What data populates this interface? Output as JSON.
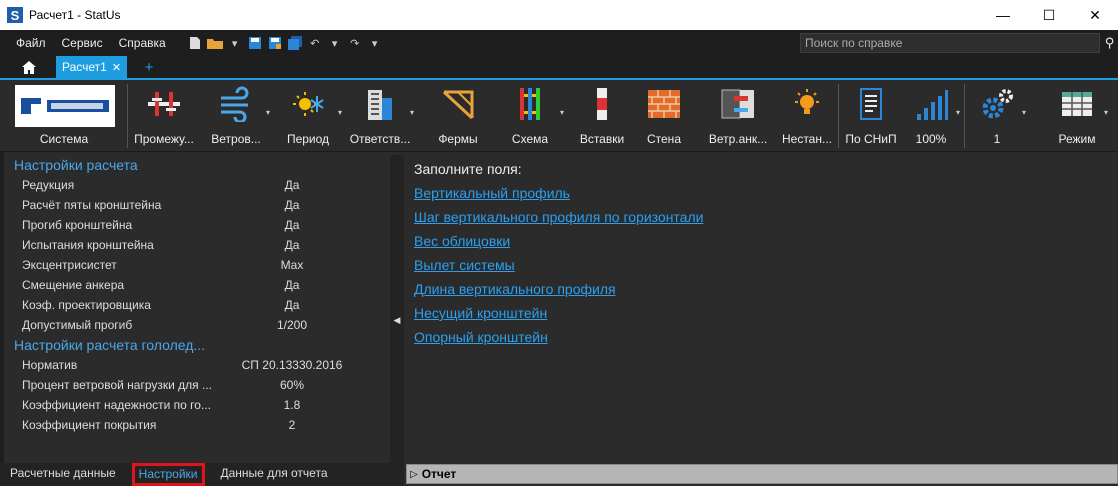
{
  "window": {
    "title": "Расчет1 - StatUs",
    "app_icon": "S"
  },
  "menu": [
    "Файл",
    "Сервис",
    "Справка"
  ],
  "search": {
    "placeholder": "Поиск по справке"
  },
  "tabs": {
    "doc_tab": "Расчет1",
    "close": "✕",
    "add": "+"
  },
  "ribbon": [
    {
      "label": "Система",
      "icon": "ukon-logo-icon"
    },
    {
      "label": "Промежу...",
      "icon": "bracket-icon"
    },
    {
      "label": "Ветров...",
      "icon": "wind-icon"
    },
    {
      "label": "Период",
      "icon": "sun-snow-icon"
    },
    {
      "label": "Ответств...",
      "icon": "building-icon"
    },
    {
      "label": "Фермы",
      "icon": "truss-icon"
    },
    {
      "label": "Схема",
      "icon": "scheme-icon"
    },
    {
      "label": "Вставки",
      "icon": "insert-icon"
    },
    {
      "label": "Стена",
      "icon": "brick-wall-icon"
    },
    {
      "label": "Ветр.анк...",
      "icon": "anchor-icon"
    },
    {
      "label": "Нестан...",
      "icon": "bulb-icon"
    },
    {
      "label": "По СНиП",
      "icon": "document-icon"
    },
    {
      "label": "100%",
      "icon": "signal-bars-icon"
    },
    {
      "label": "1",
      "icon": "gears-icon"
    },
    {
      "label": "Режим",
      "icon": "table-icon"
    }
  ],
  "settings": {
    "section1_title": "Настройки расчета",
    "section1": [
      {
        "name": "Редукция",
        "value": "Да"
      },
      {
        "name": "Расчёт пяты кронштейна",
        "value": "Да"
      },
      {
        "name": "Прогиб кронштейна",
        "value": "Да"
      },
      {
        "name": "Испытания кронштейна",
        "value": "Да"
      },
      {
        "name": "Эксцентрисистет",
        "value": "Max"
      },
      {
        "name": "Смещение анкера",
        "value": "Да"
      },
      {
        "name": "Коэф. проектировщика",
        "value": "Да"
      },
      {
        "name": "Допустимый прогиб",
        "value": "1/200"
      }
    ],
    "section2_title": "Настройки расчета гололед...",
    "section2": [
      {
        "name": "Норматив",
        "value": "СП 20.13330.2016"
      },
      {
        "name": "Процент ветровой нагрузки для ...",
        "value": "60%"
      },
      {
        "name": "Коэффициент надежности по го...",
        "value": "1.8"
      },
      {
        "name": "Коэффициент покрытия",
        "value": "2"
      }
    ]
  },
  "bottom_tabs": [
    "Расчетные данные",
    "Настройки",
    "Данные для отчета"
  ],
  "right": {
    "title": "Заполните поля:",
    "links": [
      "Вертикальный профиль",
      "Шаг вертикального профиля по горизонтали",
      "Вес облицовки",
      "Вылет системы",
      "Длина вертикального профиля",
      "Несущий кронштейн",
      "Опорный кронштейн"
    ]
  },
  "report": {
    "label": "Отчет",
    "toggle": "▷"
  },
  "colors": {
    "accent": "#1e9ee0",
    "link": "#2aa0ef",
    "highlight": "#e0141e"
  }
}
